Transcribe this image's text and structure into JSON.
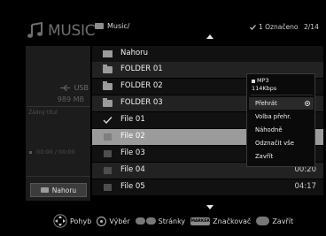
{
  "header": {
    "app_title": "MUSIC",
    "path": "Music/",
    "selected_count": "1 Označeno",
    "page": "2/14"
  },
  "left_panel": {
    "device": "USB",
    "device_size": "989 MB",
    "now_playing_label": "Žádný titul",
    "time": "00:00 / 00:00",
    "up_button": "Nahoru"
  },
  "file_list": {
    "rows": [
      {
        "name": "Nahoru",
        "type": "up",
        "duration": ""
      },
      {
        "name": "FOLDER 01",
        "type": "folder",
        "duration": ""
      },
      {
        "name": "FOLDER 02",
        "type": "folder",
        "duration": ""
      },
      {
        "name": "FOLDER 03",
        "type": "folder",
        "duration": ""
      },
      {
        "name": "File 01",
        "type": "file-checked",
        "duration": ""
      },
      {
        "name": "File 02",
        "type": "file",
        "duration": ""
      },
      {
        "name": "File 03",
        "type": "file",
        "duration": ""
      },
      {
        "name": "File 04",
        "type": "file",
        "duration": "00:20"
      },
      {
        "name": "File 05",
        "type": "file",
        "duration": "04:17"
      }
    ]
  },
  "context_menu": {
    "format": "MP3",
    "bitrate": "114Kbps",
    "items": [
      "Přehrát",
      "Volba přehr.",
      "Náhodně",
      "Odznačit vše",
      "Zavřít"
    ]
  },
  "hints": {
    "move": "Pohyb",
    "select": "Výběr",
    "pages": "Stránky",
    "mark_key": "MARKER",
    "mark": "Značkovač",
    "close": "Zavřít"
  }
}
